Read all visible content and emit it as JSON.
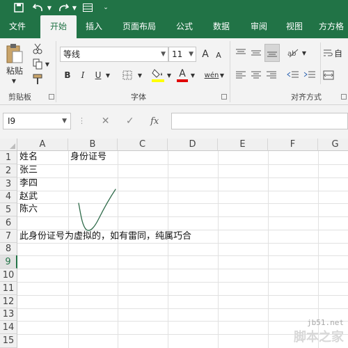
{
  "tabs": [
    {
      "label": "文件",
      "active": false
    },
    {
      "label": "开始",
      "active": true
    },
    {
      "label": "插入",
      "active": false
    },
    {
      "label": "页面布局",
      "active": false
    },
    {
      "label": "公式",
      "active": false
    },
    {
      "label": "数据",
      "active": false
    },
    {
      "label": "审阅",
      "active": false
    },
    {
      "label": "视图",
      "active": false
    },
    {
      "label": "方方格",
      "active": false
    }
  ],
  "ribbon": {
    "paste_label": "粘贴",
    "clipboard_label": "剪贴板",
    "font_group_label": "字体",
    "align_group_label": "对齐方式",
    "font_name": "等线",
    "font_size": "11",
    "bold": "B",
    "italic": "I",
    "underline": "U",
    "grow_font": "A",
    "shrink_font": "A",
    "font_color_letter": "A",
    "phonetic": "wén",
    "wrap_fragment": "自"
  },
  "formula_bar": {
    "name_box": "I9",
    "fx": "fx",
    "formula": ""
  },
  "columns": [
    "A",
    "B",
    "C",
    "D",
    "E",
    "F",
    "G"
  ],
  "rows": [
    "1",
    "2",
    "3",
    "4",
    "5",
    "6",
    "7",
    "8",
    "9",
    "10",
    "11",
    "12",
    "13",
    "14",
    "15"
  ],
  "selected_row": "9",
  "cells": {
    "A1": "姓名",
    "B1": "身份证号",
    "A2": "张三",
    "A3": "李四",
    "A4": "赵武",
    "A5": "陈六",
    "A7": "此身份证号为虚拟的，如有雷同，纯属巧合"
  },
  "watermark": {
    "url": "jb51.net",
    "name": "脚本之家"
  },
  "colors": {
    "excel_green": "#217346",
    "ink": "#2f6b4a"
  }
}
